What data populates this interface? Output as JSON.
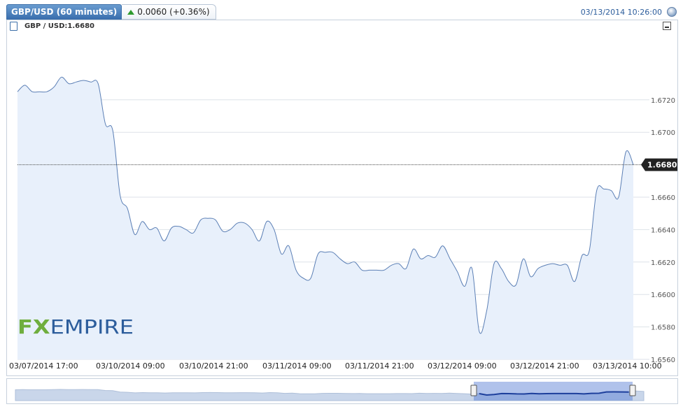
{
  "header": {
    "title": "GBP/USD (60 minutes)",
    "change": "0.0060 (+0.36%)",
    "datetime": "03/13/2014 10:26:00"
  },
  "series_label": "GBP / USD:1.6680",
  "watermark": "FXEMPIRE",
  "colors": {
    "line": "#5b7fb5",
    "fill": "#e8f0fb",
    "accent": "#3a6fae",
    "up": "#2e9a2e",
    "logo_fx": "#6fae3e",
    "logo_empire": "#2c5d9c"
  },
  "chart_data": {
    "type": "area",
    "title": "GBP/USD (60 minutes)",
    "ylim": [
      1.656,
      1.676
    ],
    "yticks": [
      "1.6560",
      "1.6580",
      "1.6600",
      "1.6620",
      "1.6640",
      "1.6660",
      "1.6680",
      "1.6700",
      "1.6720"
    ],
    "xticks": [
      "03/07/2014 17:00",
      "03/10/2014 09:00",
      "03/10/2014 21:00",
      "03/11/2014 09:00",
      "03/11/2014 21:00",
      "03/12/2014 09:00",
      "03/12/2014 21:00",
      "03/13/2014 10:00"
    ],
    "current_value": "1.6680",
    "series": [
      {
        "values": [
          1.6725,
          1.6729,
          1.6725,
          1.6725,
          1.6725,
          1.6728,
          1.6734,
          1.673,
          1.6731,
          1.6732,
          1.6731,
          1.673,
          1.6705,
          1.6701,
          1.6661,
          1.6653,
          1.6637,
          1.6645,
          1.664,
          1.6641,
          1.6633,
          1.6641,
          1.6642,
          1.664,
          1.6638,
          1.6646,
          1.6647,
          1.6646,
          1.6639,
          1.664,
          1.6644,
          1.6644,
          1.664,
          1.6633,
          1.6645,
          1.664,
          1.6625,
          1.663,
          1.6615,
          1.661,
          1.661,
          1.6625,
          1.6626,
          1.6626,
          1.6622,
          1.6619,
          1.662,
          1.6615,
          1.6615,
          1.6615,
          1.6615,
          1.6618,
          1.6619,
          1.6616,
          1.6628,
          1.6622,
          1.6624,
          1.6623,
          1.663,
          1.6622,
          1.6614,
          1.6605,
          1.6616,
          1.6577,
          1.659,
          1.6619,
          1.6616,
          1.6608,
          1.6606,
          1.6622,
          1.6611,
          1.6616,
          1.6618,
          1.6619,
          1.6618,
          1.6618,
          1.6608,
          1.6624,
          1.6627,
          1.6664,
          1.6665,
          1.6664,
          1.666,
          1.6688,
          1.668
        ]
      }
    ]
  }
}
